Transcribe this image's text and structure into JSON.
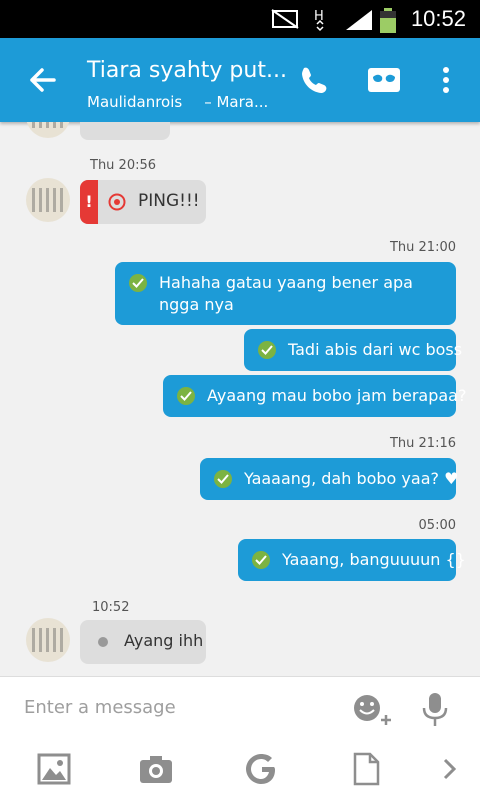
{
  "status_bar": {
    "time": "10:52"
  },
  "header": {
    "title": "Tiara syahty put...",
    "subtitle_primary": "Maulidanrois",
    "subtitle_secondary": "– Mara..."
  },
  "messages": {
    "ts_in_1": "Thu 20:56",
    "ping_label": "PING!!!",
    "ts_out_1": "Thu 21:00",
    "out_1": "Hahaha gatau yaang bener apa ngga nya",
    "out_2": "Tadi abis dari wc boss",
    "out_3": "Ayaang mau bobo jam berapaa?",
    "ts_out_2": "Thu 21:16",
    "out_4": "Yaaaang, dah bobo yaa? ♥",
    "ts_out_3": "05:00",
    "out_5": "Yaaang, banguuuun {}",
    "ts_in_2": "10:52",
    "in_2": "Ayang ihh"
  },
  "composer": {
    "placeholder": "Enter a message"
  },
  "colors": {
    "brand": "#1d9bd7",
    "check": "#7cb342",
    "ping": "#e53935"
  },
  "icons": [
    "back-arrow-icon",
    "phone-icon",
    "incognito-mask-icon",
    "overflow-menu-icon",
    "emoji-add-icon",
    "microphone-icon",
    "image-icon",
    "camera-icon",
    "google-icon",
    "document-icon",
    "chevron-right-icon"
  ]
}
